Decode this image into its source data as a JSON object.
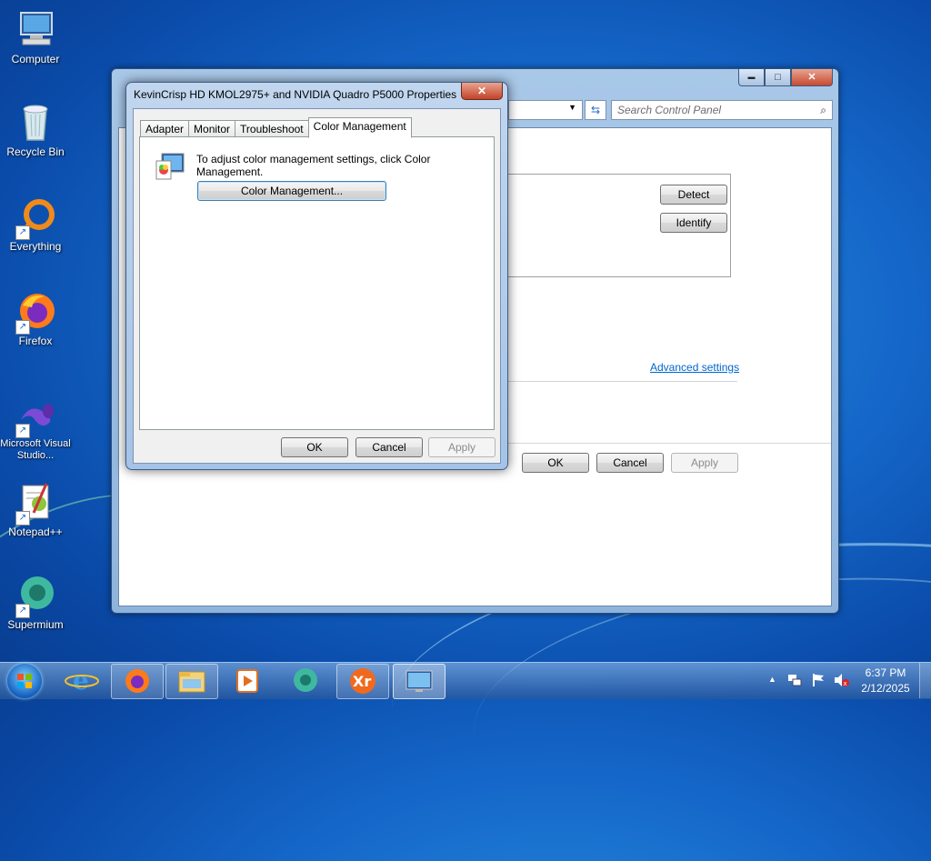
{
  "desktop": {
    "icons": [
      {
        "label": "Computer"
      },
      {
        "label": "Recycle Bin"
      },
      {
        "label": "Everything"
      },
      {
        "label": "Firefox"
      },
      {
        "label": "Microsoft Visual Studio..."
      },
      {
        "label": "Notepad++"
      },
      {
        "label": "Supermium"
      }
    ]
  },
  "back_window": {
    "search_placeholder": "Search Control Panel",
    "detect_label": "Detect",
    "identify_label": "Identify",
    "advanced_link": "Advanced settings",
    "ok_label": "OK",
    "cancel_label": "Cancel",
    "apply_label": "Apply",
    "controls": {
      "minimize": "▬",
      "maximize": "□",
      "close": "✕"
    }
  },
  "dialog": {
    "title": "KevinCrisp HD KMOL2975+ and NVIDIA Quadro P5000 Properties",
    "close_glyph": "✕",
    "tabs": [
      {
        "label": "Adapter"
      },
      {
        "label": "Monitor"
      },
      {
        "label": "Troubleshoot"
      },
      {
        "label": "Color Management",
        "active": true
      }
    ],
    "description": "To adjust color management settings, click Color Management.",
    "color_mgmt_button": "Color Management...",
    "ok_label": "OK",
    "cancel_label": "Cancel",
    "apply_label": "Apply"
  },
  "taskbar": {
    "time": "6:37 PM",
    "date": "2/12/2025",
    "apps": [
      "ie-icon",
      "firefox-icon",
      "explorer-icon",
      "media-player-icon",
      "supermium-icon",
      "xr-icon",
      "display-settings-icon"
    ]
  },
  "colors": {
    "accent": "#1466c8",
    "link": "#0066cc"
  }
}
